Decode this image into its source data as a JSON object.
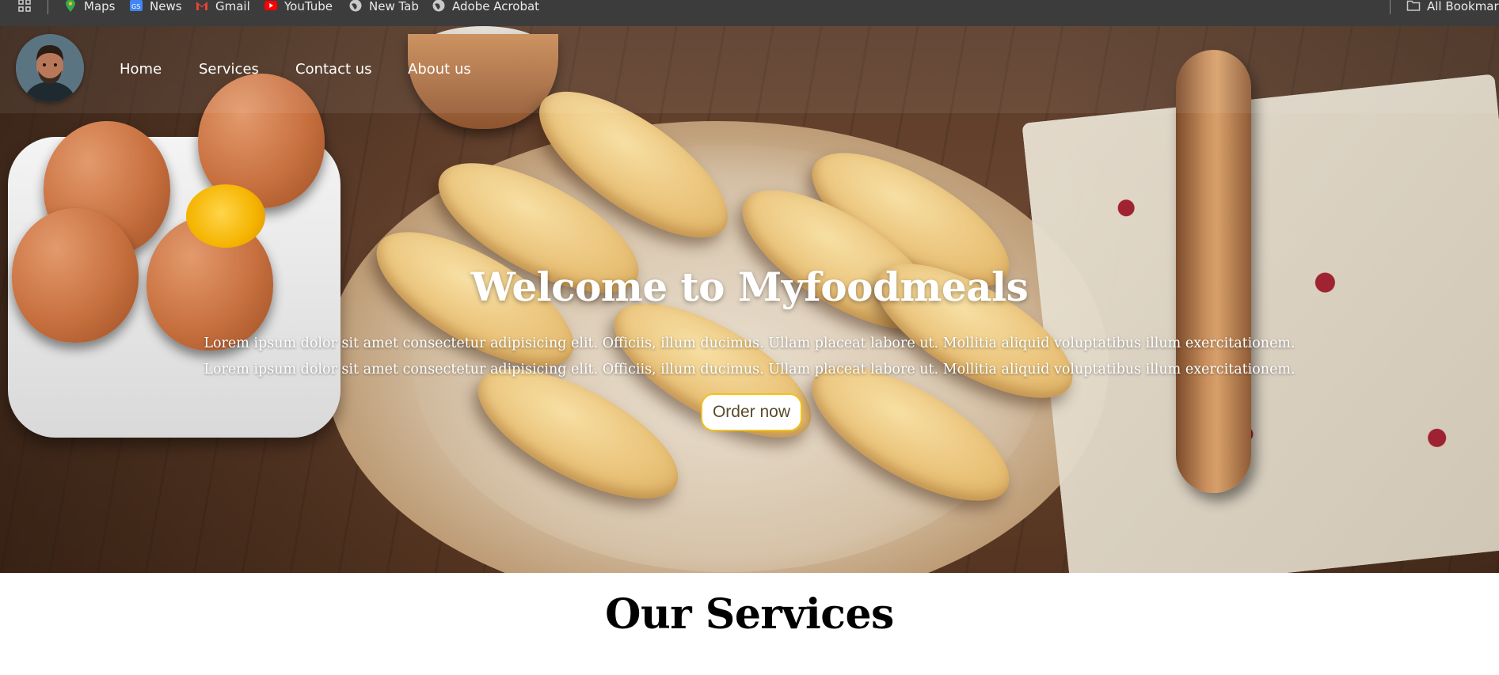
{
  "bookmarks_bar": {
    "items": [
      {
        "label": "Maps",
        "icon": "maps-icon"
      },
      {
        "label": "News",
        "icon": "news-icon"
      },
      {
        "label": "Gmail",
        "icon": "gmail-icon"
      },
      {
        "label": "YouTube",
        "icon": "youtube-icon"
      },
      {
        "label": "New Tab",
        "icon": "globe-icon"
      },
      {
        "label": "Adobe Acrobat",
        "icon": "globe-icon"
      }
    ],
    "all_bookmarks_label": "All Bookmarks"
  },
  "nav": {
    "avatar_icon": "user-avatar",
    "links": [
      "Home",
      "Services",
      "Contact us",
      "About us"
    ]
  },
  "hero": {
    "title": "Welcome to Myfoodmeals",
    "paragraph_line1": "Lorem ipsum dolor sit amet consectetur adipisicing elit. Officiis, illum ducimus. Ullam placeat labore ut. Mollitia aliquid voluptatibus illum exercitationem.",
    "paragraph_line2": "Lorem ipsum dolor sit amet consectetur adipisicing elit. Officiis, illum ducimus. Ullam placeat labore ut. Mollitia aliquid voluptatibus illum exercitationem.",
    "order_button": "Order now",
    "button_border_color": "#f1c21b"
  },
  "services": {
    "title": "Our Services"
  }
}
